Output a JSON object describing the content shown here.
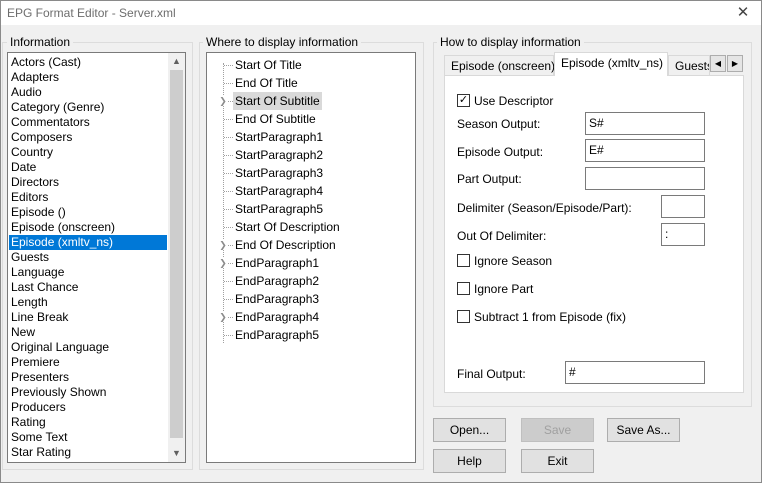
{
  "window": {
    "title": "EPG Format Editor - Server.xml",
    "close_glyph": "✕"
  },
  "information": {
    "group_title": "Information",
    "items": [
      "Actors (Cast)",
      "Adapters",
      "Audio",
      "Category (Genre)",
      "Commentators",
      "Composers",
      "Country",
      "Date",
      "Directors",
      "Editors",
      "Episode ()",
      "Episode (onscreen)",
      "Episode (xmltv_ns)",
      "Guests",
      "Language",
      "Last Chance",
      "Length",
      "Line Break",
      "New",
      "Original Language",
      "Premiere",
      "Presenters",
      "Previously Shown",
      "Producers",
      "Rating",
      "Some Text",
      "Star Rating"
    ],
    "selected": "Episode (xmltv_ns)",
    "scroll_up_glyph": "▲",
    "scroll_down_glyph": "▼"
  },
  "where": {
    "group_title": "Where to display information",
    "items": [
      {
        "label": "Start Of Title",
        "expandable": false
      },
      {
        "label": "End Of Title",
        "expandable": false
      },
      {
        "label": "Start Of Subtitle",
        "expandable": true,
        "selected": true
      },
      {
        "label": "End Of Subtitle",
        "expandable": false
      },
      {
        "label": "StartParagraph1",
        "expandable": false
      },
      {
        "label": "StartParagraph2",
        "expandable": false
      },
      {
        "label": "StartParagraph3",
        "expandable": false
      },
      {
        "label": "StartParagraph4",
        "expandable": false
      },
      {
        "label": "StartParagraph5",
        "expandable": false
      },
      {
        "label": "Start Of Description",
        "expandable": false
      },
      {
        "label": "End Of Description",
        "expandable": true
      },
      {
        "label": "EndParagraph1",
        "expandable": true
      },
      {
        "label": "EndParagraph2",
        "expandable": false
      },
      {
        "label": "EndParagraph3",
        "expandable": false
      },
      {
        "label": "EndParagraph4",
        "expandable": true
      },
      {
        "label": "EndParagraph5",
        "expandable": false
      }
    ],
    "expand_glyph": "❯"
  },
  "how": {
    "group_title": "How to display information",
    "tabs": [
      "Episode (onscreen)",
      "Episode (xmltv_ns)",
      "Guests"
    ],
    "active_tab": "Episode (xmltv_ns)",
    "tab_scroll_left": "◀",
    "tab_scroll_right": "▶",
    "use_descriptor": {
      "label": "Use Descriptor",
      "checked": true,
      "check_glyph": "✓"
    },
    "season_output": {
      "label": "Season Output:",
      "value": "S#"
    },
    "episode_output": {
      "label": "Episode Output:",
      "value": "E#"
    },
    "part_output": {
      "label": "Part Output:",
      "value": ""
    },
    "delimiter": {
      "label": "Delimiter (Season/Episode/Part):",
      "value": ""
    },
    "out_of_delimiter": {
      "label": "Out Of Delimiter:",
      "value": ":"
    },
    "ignore_season": {
      "label": "Ignore Season",
      "checked": false
    },
    "ignore_part": {
      "label": "Ignore Part",
      "checked": false
    },
    "subtract_one": {
      "label": "Subtract 1 from Episode (fix)",
      "checked": false
    },
    "final_output": {
      "label": "Final Output:",
      "value": "#"
    }
  },
  "buttons": {
    "open": "Open...",
    "save": "Save",
    "save_as": "Save As...",
    "help": "Help",
    "exit": "Exit"
  },
  "colors": {
    "selection": "#0078d7",
    "tree_selection": "#d9d9d9",
    "window_bg": "#f0f0f0"
  }
}
